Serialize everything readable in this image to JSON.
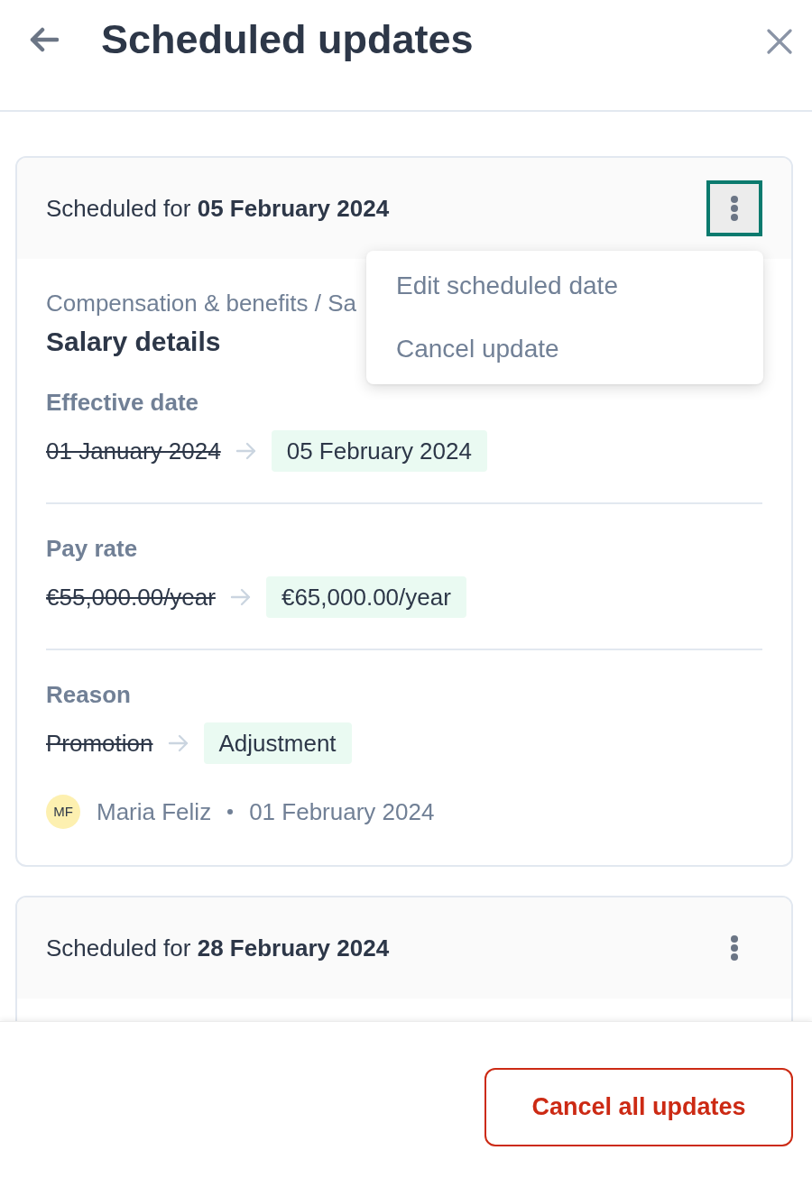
{
  "header": {
    "title": "Scheduled updates"
  },
  "updates": [
    {
      "heading": "Scheduled for **05 February 2024**",
      "menu_open": true,
      "menu_items": [
        "Edit scheduled date",
        "Cancel update"
      ],
      "breadcrumb": "Compensation & benefits / Sa",
      "title": "Salary details",
      "fields": [
        {
          "label": "Effective date",
          "old_value": "01 January 2024",
          "new_value": "05 February 2024"
        },
        {
          "label": "Pay rate",
          "old_value": "€55,000.00/year",
          "new_value": "€65,000.00/year"
        },
        {
          "label": "Reason",
          "old_value": "Promotion",
          "new_value": "Adjustment"
        }
      ],
      "author": {
        "initials": "MF",
        "name": "Maria Feliz",
        "date": "01 February 2024"
      }
    },
    {
      "heading": "Scheduled for **28 February 2024**",
      "menu_open": false
    }
  ],
  "footer": {
    "button": "Cancel all updates"
  }
}
